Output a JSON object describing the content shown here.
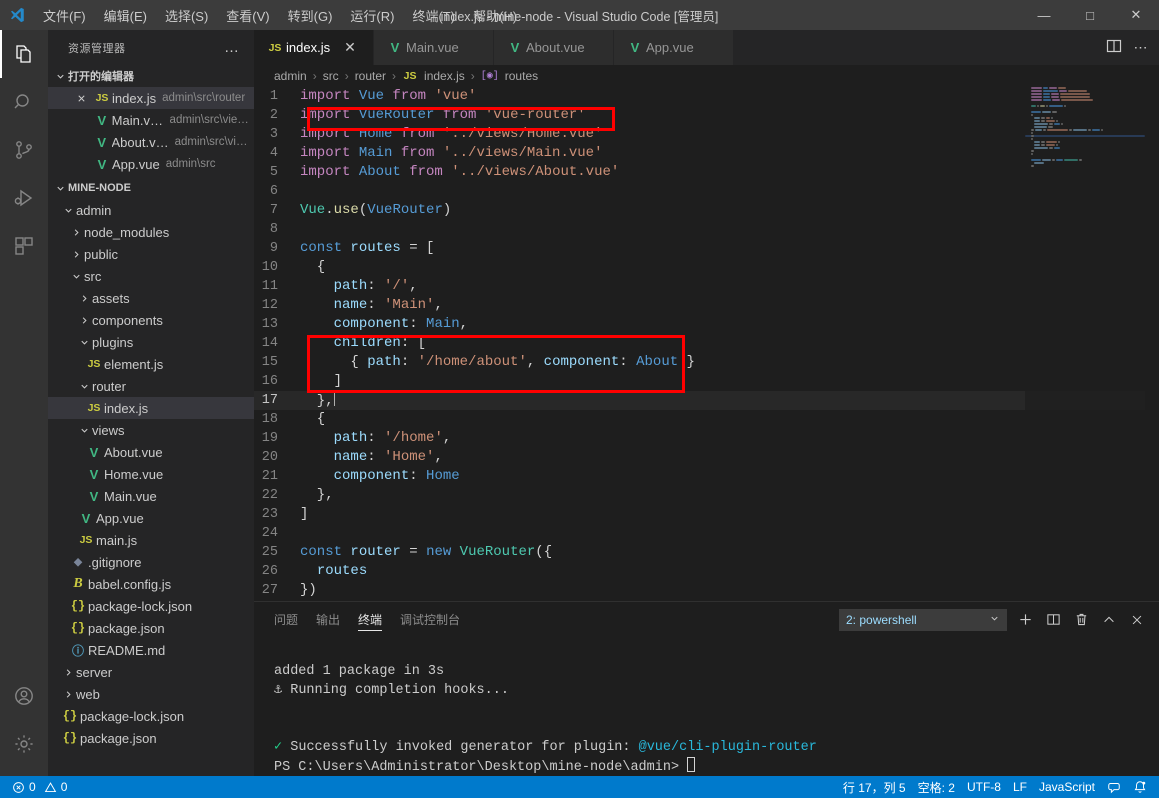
{
  "titlebar": {
    "window_title": "index.js - mine-node - Visual Studio Code [管理员]",
    "menu": [
      {
        "label": "文件(F)"
      },
      {
        "label": "编辑(E)"
      },
      {
        "label": "选择(S)"
      },
      {
        "label": "查看(V)"
      },
      {
        "label": "转到(G)"
      },
      {
        "label": "运行(R)"
      },
      {
        "label": "终端(T)"
      },
      {
        "label": "帮助(H)"
      }
    ],
    "minimize": "—",
    "maximize": "□",
    "close": "✕"
  },
  "activitybar": {
    "items": [
      {
        "name": "explorer",
        "active": true
      },
      {
        "name": "search",
        "active": false
      },
      {
        "name": "source-control",
        "active": false
      },
      {
        "name": "run-debug",
        "active": false
      },
      {
        "name": "extensions",
        "active": false
      }
    ],
    "bottom": [
      {
        "name": "account"
      },
      {
        "name": "settings-gear"
      }
    ]
  },
  "sidebar": {
    "header": "资源管理器",
    "more_actions": "…",
    "open_editors": {
      "title": "打开的编辑器",
      "items": [
        {
          "name": "index.js",
          "desc": "admin\\src\\router",
          "icon": "js",
          "selected": true,
          "closable": true
        },
        {
          "name": "Main.vue",
          "desc": "admin\\src\\views",
          "icon": "vue",
          "selected": false,
          "closable": false
        },
        {
          "name": "About.vue",
          "desc": "admin\\src\\vie...",
          "icon": "vue",
          "selected": false,
          "closable": false
        },
        {
          "name": "App.vue",
          "desc": "admin\\src",
          "icon": "vue",
          "selected": false,
          "closable": false
        }
      ]
    },
    "project": {
      "title": "MINE-NODE",
      "tree": [
        {
          "label": "admin",
          "type": "folder",
          "expanded": true,
          "indent": 1
        },
        {
          "label": "node_modules",
          "type": "folder",
          "expanded": false,
          "indent": 2
        },
        {
          "label": "public",
          "type": "folder",
          "expanded": false,
          "indent": 2
        },
        {
          "label": "src",
          "type": "folder",
          "expanded": true,
          "indent": 2
        },
        {
          "label": "assets",
          "type": "folder",
          "expanded": false,
          "indent": 3
        },
        {
          "label": "components",
          "type": "folder",
          "expanded": false,
          "indent": 3
        },
        {
          "label": "plugins",
          "type": "folder",
          "expanded": true,
          "indent": 3
        },
        {
          "label": "element.js",
          "type": "file",
          "icon": "js",
          "indent": 4
        },
        {
          "label": "router",
          "type": "folder",
          "expanded": true,
          "indent": 3
        },
        {
          "label": "index.js",
          "type": "file",
          "icon": "js",
          "indent": 4,
          "selected": true
        },
        {
          "label": "views",
          "type": "folder",
          "expanded": true,
          "indent": 3
        },
        {
          "label": "About.vue",
          "type": "file",
          "icon": "vue",
          "indent": 4
        },
        {
          "label": "Home.vue",
          "type": "file",
          "icon": "vue",
          "indent": 4
        },
        {
          "label": "Main.vue",
          "type": "file",
          "icon": "vue",
          "indent": 4
        },
        {
          "label": "App.vue",
          "type": "file",
          "icon": "vue",
          "indent": 3
        },
        {
          "label": "main.js",
          "type": "file",
          "icon": "js",
          "indent": 3
        },
        {
          "label": ".gitignore",
          "type": "file",
          "icon": "git",
          "indent": 2
        },
        {
          "label": "babel.config.js",
          "type": "file",
          "icon": "babel",
          "indent": 2
        },
        {
          "label": "package-lock.json",
          "type": "file",
          "icon": "json",
          "indent": 2
        },
        {
          "label": "package.json",
          "type": "file",
          "icon": "json",
          "indent": 2
        },
        {
          "label": "README.md",
          "type": "file",
          "icon": "md",
          "indent": 2
        },
        {
          "label": "server",
          "type": "folder",
          "expanded": false,
          "indent": 1
        },
        {
          "label": "web",
          "type": "folder",
          "expanded": false,
          "indent": 1
        },
        {
          "label": "package-lock.json",
          "type": "file",
          "icon": "json",
          "indent": 1
        },
        {
          "label": "package.json",
          "type": "file",
          "icon": "json",
          "indent": 1
        }
      ]
    }
  },
  "editor": {
    "tabs": [
      {
        "label": "index.js",
        "icon": "js",
        "active": true,
        "closable": true
      },
      {
        "label": "Main.vue",
        "icon": "vue",
        "active": false,
        "closable": false
      },
      {
        "label": "About.vue",
        "icon": "vue",
        "active": false,
        "closable": false
      },
      {
        "label": "App.vue",
        "icon": "vue",
        "active": false,
        "closable": false
      }
    ],
    "tab_close": "✕",
    "breadcrumb": [
      "admin",
      "src",
      "router",
      "index.js",
      "routes"
    ],
    "breadcrumb_separator": "›",
    "lines": [
      {
        "n": 1,
        "segs": [
          {
            "t": "import ",
            "c": "kw"
          },
          {
            "t": "Vue",
            "c": "blue"
          },
          {
            "t": " from ",
            "c": "kw"
          },
          {
            "t": "'vue'",
            "c": "str"
          }
        ]
      },
      {
        "n": 2,
        "segs": [
          {
            "t": "import ",
            "c": "kw"
          },
          {
            "t": "VueRouter",
            "c": "blue"
          },
          {
            "t": " from ",
            "c": "kw"
          },
          {
            "t": "'vue-router'",
            "c": "str"
          }
        ]
      },
      {
        "n": 3,
        "segs": [
          {
            "t": "import ",
            "c": "kw"
          },
          {
            "t": "Home",
            "c": "blue"
          },
          {
            "t": " from ",
            "c": "kw"
          },
          {
            "t": "'../views/Home.vue'",
            "c": "str"
          }
        ]
      },
      {
        "n": 4,
        "segs": [
          {
            "t": "import ",
            "c": "kw"
          },
          {
            "t": "Main",
            "c": "blue"
          },
          {
            "t": " from ",
            "c": "kw"
          },
          {
            "t": "'../views/Main.vue'",
            "c": "str"
          }
        ]
      },
      {
        "n": 5,
        "segs": [
          {
            "t": "import ",
            "c": "kw"
          },
          {
            "t": "About",
            "c": "blue"
          },
          {
            "t": " from ",
            "c": "kw"
          },
          {
            "t": "'../views/About.vue'",
            "c": "str"
          }
        ]
      },
      {
        "n": 6,
        "segs": []
      },
      {
        "n": 7,
        "segs": [
          {
            "t": "Vue",
            "c": "teal"
          },
          {
            "t": ".",
            "c": "plain"
          },
          {
            "t": "use",
            "c": "fn"
          },
          {
            "t": "(",
            "c": "plain"
          },
          {
            "t": "VueRouter",
            "c": "blue"
          },
          {
            "t": ")",
            "c": "plain"
          }
        ]
      },
      {
        "n": 8,
        "segs": []
      },
      {
        "n": 9,
        "segs": [
          {
            "t": "const ",
            "c": "blue"
          },
          {
            "t": "routes",
            "c": "var"
          },
          {
            "t": " = [",
            "c": "plain"
          }
        ]
      },
      {
        "n": 10,
        "segs": [
          {
            "t": "  {",
            "c": "plain"
          }
        ]
      },
      {
        "n": 11,
        "segs": [
          {
            "t": "    ",
            "c": "plain"
          },
          {
            "t": "path",
            "c": "var"
          },
          {
            "t": ": ",
            "c": "plain"
          },
          {
            "t": "'/'",
            "c": "str"
          },
          {
            "t": ",",
            "c": "plain"
          }
        ]
      },
      {
        "n": 12,
        "segs": [
          {
            "t": "    ",
            "c": "plain"
          },
          {
            "t": "name",
            "c": "var"
          },
          {
            "t": ": ",
            "c": "plain"
          },
          {
            "t": "'Main'",
            "c": "str"
          },
          {
            "t": ",",
            "c": "plain"
          }
        ]
      },
      {
        "n": 13,
        "segs": [
          {
            "t": "    ",
            "c": "plain"
          },
          {
            "t": "component",
            "c": "var"
          },
          {
            "t": ": ",
            "c": "plain"
          },
          {
            "t": "Main",
            "c": "blue"
          },
          {
            "t": ",",
            "c": "plain"
          }
        ]
      },
      {
        "n": 14,
        "segs": [
          {
            "t": "    ",
            "c": "plain"
          },
          {
            "t": "children",
            "c": "var"
          },
          {
            "t": ": [",
            "c": "plain"
          }
        ]
      },
      {
        "n": 15,
        "segs": [
          {
            "t": "      { ",
            "c": "plain"
          },
          {
            "t": "path",
            "c": "var"
          },
          {
            "t": ": ",
            "c": "plain"
          },
          {
            "t": "'/home/about'",
            "c": "str"
          },
          {
            "t": ", ",
            "c": "plain"
          },
          {
            "t": "component",
            "c": "var"
          },
          {
            "t": ": ",
            "c": "plain"
          },
          {
            "t": "About",
            "c": "blue"
          },
          {
            "t": " }",
            "c": "plain"
          }
        ]
      },
      {
        "n": 16,
        "segs": [
          {
            "t": "    ]",
            "c": "plain"
          }
        ]
      },
      {
        "n": 17,
        "segs": [
          {
            "t": "  },",
            "c": "plain"
          }
        ],
        "current": true
      },
      {
        "n": 18,
        "segs": [
          {
            "t": "  {",
            "c": "plain"
          }
        ]
      },
      {
        "n": 19,
        "segs": [
          {
            "t": "    ",
            "c": "plain"
          },
          {
            "t": "path",
            "c": "var"
          },
          {
            "t": ": ",
            "c": "plain"
          },
          {
            "t": "'/home'",
            "c": "str"
          },
          {
            "t": ",",
            "c": "plain"
          }
        ]
      },
      {
        "n": 20,
        "segs": [
          {
            "t": "    ",
            "c": "plain"
          },
          {
            "t": "name",
            "c": "var"
          },
          {
            "t": ": ",
            "c": "plain"
          },
          {
            "t": "'Home'",
            "c": "str"
          },
          {
            "t": ",",
            "c": "plain"
          }
        ]
      },
      {
        "n": 21,
        "segs": [
          {
            "t": "    ",
            "c": "plain"
          },
          {
            "t": "component",
            "c": "var"
          },
          {
            "t": ": ",
            "c": "plain"
          },
          {
            "t": "Home",
            "c": "blue"
          }
        ]
      },
      {
        "n": 22,
        "segs": [
          {
            "t": "  },",
            "c": "plain"
          }
        ]
      },
      {
        "n": 23,
        "segs": [
          {
            "t": "]",
            "c": "plain"
          }
        ]
      },
      {
        "n": 24,
        "segs": []
      },
      {
        "n": 25,
        "segs": [
          {
            "t": "const ",
            "c": "blue"
          },
          {
            "t": "router",
            "c": "var"
          },
          {
            "t": " = ",
            "c": "plain"
          },
          {
            "t": "new ",
            "c": "blue"
          },
          {
            "t": "VueRouter",
            "c": "teal"
          },
          {
            "t": "({",
            "c": "plain"
          }
        ]
      },
      {
        "n": 26,
        "segs": [
          {
            "t": "  ",
            "c": "plain"
          },
          {
            "t": "routes",
            "c": "var"
          }
        ]
      },
      {
        "n": 27,
        "segs": [
          {
            "t": "})",
            "c": "plain"
          }
        ]
      }
    ],
    "highlight_color": "#ff0000",
    "split_icon": "split-editor",
    "more_icon": "more-actions"
  },
  "panel": {
    "tabs": [
      {
        "label": "问题",
        "active": false
      },
      {
        "label": "输出",
        "active": false
      },
      {
        "label": "终端",
        "active": true
      },
      {
        "label": "调试控制台",
        "active": false
      }
    ],
    "terminal_select": "2: powershell",
    "actions": [
      "add-terminal",
      "split-terminal",
      "kill-terminal",
      "maximize-panel",
      "close-panel"
    ],
    "terminal_lines": [
      {
        "text": "",
        "cls": ""
      },
      {
        "text": "",
        "cls": ""
      },
      {
        "text": "added 1 package in 3s",
        "cls": ""
      },
      {
        "text": "⚓  Running completion hooks...",
        "cls": ""
      },
      {
        "text": "",
        "cls": ""
      },
      {
        "text": "✓ Successfully invoked generator for plugin: @vue/cli-plugin-router",
        "cls": "mixed"
      }
    ],
    "term_success_check": "✓",
    "term_success_text": "Successfully invoked generator for plugin: ",
    "term_success_plugin": "@vue/cli-plugin-router",
    "prompt": "PS C:\\Users\\Administrator\\Desktop\\mine-node\\admin>"
  },
  "statusbar": {
    "errors": "0",
    "warnings": "0",
    "position": "行 17，列 5",
    "spaces": "空格: 2",
    "encoding": "UTF-8",
    "eol": "LF",
    "language": "JavaScript",
    "feedback_icon": "feedback-icon",
    "bell_icon": "bell-icon",
    "accent": "#007acc"
  }
}
